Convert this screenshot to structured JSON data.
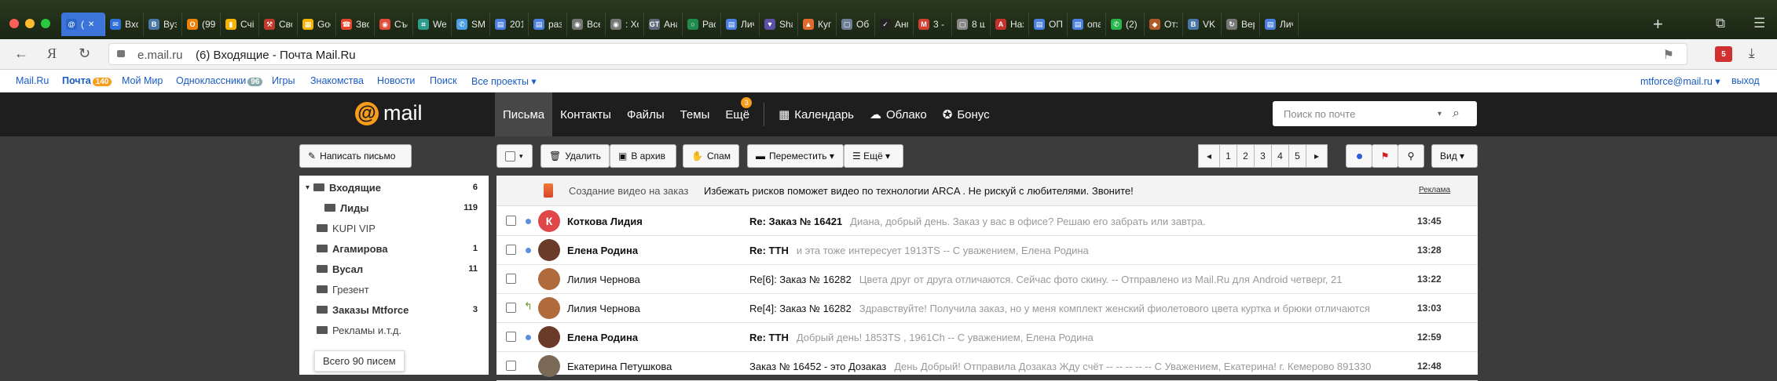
{
  "browser": {
    "tabs": [
      {
        "label": "(",
        "icon": "mail-at-icon",
        "color": "#2a64c8",
        "glyph": "@",
        "active": true
      },
      {
        "label": "Вхо",
        "icon": "mail-icon",
        "color": "#2f6fdc",
        "glyph": "✉"
      },
      {
        "label": "Вуз",
        "icon": "vk-icon",
        "color": "#4a76a8",
        "glyph": "В"
      },
      {
        "label": "(99",
        "icon": "ok-icon",
        "color": "#ee8208",
        "glyph": "О"
      },
      {
        "label": "Счі",
        "icon": "chart-icon",
        "color": "#f4b400",
        "glyph": "▮"
      },
      {
        "label": "Сво",
        "icon": "tool-icon",
        "color": "#c0392b",
        "glyph": "⚒"
      },
      {
        "label": "Goo",
        "icon": "sheets-icon",
        "color": "#f4b400",
        "glyph": "▦"
      },
      {
        "label": "Зво",
        "icon": "phone-icon",
        "color": "#e2472d",
        "glyph": "☎"
      },
      {
        "label": "Съе",
        "icon": "eye-icon",
        "color": "#e34b3a",
        "glyph": "◉"
      },
      {
        "label": "We",
        "icon": "grid-icon",
        "color": "#2e9c8c",
        "glyph": "⌗"
      },
      {
        "label": "SM",
        "icon": "chat-icon",
        "color": "#4aa0e6",
        "glyph": "✆"
      },
      {
        "label": "201",
        "icon": "doc-icon",
        "color": "#4a7fe0",
        "glyph": "▤"
      },
      {
        "label": "раз",
        "icon": "doc-icon",
        "color": "#4a7fe0",
        "glyph": "▤"
      },
      {
        "label": "Все",
        "icon": "eye-icon",
        "color": "#777777",
        "glyph": "◉"
      },
      {
        "label": ": Хо",
        "icon": "eye-icon",
        "color": "#777777",
        "glyph": "◉"
      },
      {
        "label": "Ана",
        "icon": "gt-icon",
        "color": "#5f6b7a",
        "glyph": "GT"
      },
      {
        "label": "Рас",
        "icon": "ring-icon",
        "color": "#1f8b4c",
        "glyph": "○"
      },
      {
        "label": "Лич",
        "icon": "doc-icon",
        "color": "#4a7fe0",
        "glyph": "▤"
      },
      {
        "label": "Sha",
        "icon": "shield-icon",
        "color": "#5b4fa8",
        "glyph": "▼"
      },
      {
        "label": "Куп",
        "icon": "cart-icon",
        "color": "#e06b2d",
        "glyph": "▲"
      },
      {
        "label": "Об(",
        "icon": "file-icon",
        "color": "#6e7f95",
        "glyph": "▢"
      },
      {
        "label": "Анг",
        "icon": "check-icon",
        "color": "#222222",
        "glyph": "✓"
      },
      {
        "label": "3 -",
        "icon": "gmail-icon",
        "color": "#d23f31",
        "glyph": "M"
      },
      {
        "label": "8 ш",
        "icon": "page-icon",
        "color": "#888888",
        "glyph": "▢"
      },
      {
        "label": "Наз",
        "icon": "pdf-icon",
        "color": "#c7302b",
        "glyph": "A"
      },
      {
        "label": "ОП",
        "icon": "doc-icon",
        "color": "#4a7fe0",
        "glyph": "▤"
      },
      {
        "label": "опа",
        "icon": "doc-icon",
        "color": "#4a7fe0",
        "glyph": "▤"
      },
      {
        "label": "(2)",
        "icon": "whatsapp-icon",
        "color": "#29b34a",
        "glyph": "✆"
      },
      {
        "label": "Отз",
        "icon": "bird-icon",
        "color": "#b05a2a",
        "glyph": "◆"
      },
      {
        "label": "VK",
        "icon": "vk-icon",
        "color": "#4a76a8",
        "glyph": "В"
      },
      {
        "label": "Вер",
        "icon": "reload-icon",
        "color": "#777777",
        "glyph": "↻"
      },
      {
        "label": "Лич",
        "icon": "doc-icon",
        "color": "#4a7fe0",
        "glyph": "▤"
      }
    ],
    "new_tab": "+",
    "address": {
      "domain": "e.mail.ru",
      "title": "(6) Входящие - Почта Mail.Ru"
    },
    "ext_badge": "5"
  },
  "portal": {
    "links": [
      {
        "label": "Mail.Ru"
      },
      {
        "label": "Почта",
        "badge": "140",
        "bold": true
      },
      {
        "label": "Мой Мир"
      },
      {
        "label": "Одноклассники",
        "badge": "96"
      },
      {
        "label": "Игры"
      },
      {
        "label": "Знакомства"
      },
      {
        "label": "Новости"
      },
      {
        "label": "Поиск"
      },
      {
        "label": "Все проекты ▾"
      }
    ],
    "user": "mtforce@mail.ru ▾",
    "logout": "выход"
  },
  "mail_header": {
    "logo_at": "@",
    "logo_word": "mail",
    "nav": {
      "letters": "Письма",
      "contacts": "Контакты",
      "files": "Файлы",
      "themes": "Темы",
      "more": "Ещё",
      "more_badge": "3",
      "calendar": "Календарь",
      "cloud": "Облако",
      "bonus": "Бонус"
    },
    "search_placeholder": "Поиск по почте"
  },
  "toolbar": {
    "compose": "Написать письмо",
    "delete": "Удалить",
    "archive": "В архив",
    "spam": "Спам",
    "move": "Переместить ▾",
    "more": "☰ Ещё ▾",
    "pages": [
      "◂",
      "1",
      "2",
      "3",
      "4",
      "5",
      "▸"
    ],
    "view": "Вид ▾"
  },
  "folders": [
    {
      "name": "Входящие",
      "count": "6",
      "bold": true,
      "arrow": "▾",
      "indent": 0
    },
    {
      "name": "Лиды",
      "count": "119",
      "bold": true,
      "indent": 1
    },
    {
      "name": "KUPI VIP",
      "count": "",
      "bold": false,
      "indent": 0
    },
    {
      "name": "Агамирова",
      "count": "1",
      "bold": true,
      "indent": 0
    },
    {
      "name": "Вусал",
      "count": "11",
      "bold": true,
      "indent": 0
    },
    {
      "name": "Грезент",
      "count": "",
      "bold": false,
      "indent": 0
    },
    {
      "name": "Заказы Mtforce",
      "count": "3",
      "bold": true,
      "indent": 0
    },
    {
      "name": "Рекламы и.т.д.",
      "count": "",
      "bold": false,
      "indent": 0
    }
  ],
  "total_messages": "Всего 90 писем",
  "ad": {
    "sender": "Создание видео на заказ",
    "text": "Избежать рисков поможет видео по технологии ARCA . Не рискуй с любителями. Звоните!",
    "label": "Реклама"
  },
  "messages": [
    {
      "sender": "Коткова Лидия",
      "subject": "Re: Заказ № 16421",
      "snippet": "Диана, добрый день. Заказ у вас в офисе? Решаю его забрать или завтра.",
      "time": "13:45",
      "unread": true,
      "avatar_letter": "К",
      "avatar_color": "#e0474b"
    },
    {
      "sender": "Елена Родина",
      "subject": "Re: ТТН",
      "snippet": "и эта тоже интересует 1913TS -- С уважением, Елена Родина",
      "time": "13:28",
      "unread": true,
      "avatar_letter": "",
      "avatar_color": "#6b3b2a"
    },
    {
      "sender": "Лилия Чернова",
      "subject": "Re[6]: Заказ № 16282",
      "snippet": "Цвета друг от друга отличаются. Сейчас фото скину. -- Отправлено из Mail.Ru для Android четверг, 21",
      "time": "13:22",
      "unread": false,
      "avatar_letter": "",
      "avatar_color": "#b06a3c"
    },
    {
      "sender": "Лилия Чернова",
      "subject": "Re[4]: Заказ № 16282",
      "snippet": "Здравствуйте! Получила заказ, но у меня комплект женский фиолетового цвета куртка и брюки отличаются",
      "time": "13:03",
      "unread": false,
      "replied": true,
      "avatar_letter": "",
      "avatar_color": "#b06a3c"
    },
    {
      "sender": "Елена Родина",
      "subject": "Re: ТТН",
      "snippet": "Добрый день! 1853TS , 1961Ch -- С уважением, Елена Родина",
      "time": "12:59",
      "unread": true,
      "avatar_letter": "",
      "avatar_color": "#6b3b2a"
    },
    {
      "sender": "Екатерина Петушкова",
      "subject": "Заказ № 16452 - это Дозаказ",
      "snippet": "День Добрый! Отправила Дозаказ Жду счёт -- -- -- -- -- С Уважением, Екатерина! г. Кемерово 891330",
      "time": "12:48",
      "unread": false,
      "avatar_letter": "",
      "avatar_color": "#7a6a55"
    }
  ]
}
